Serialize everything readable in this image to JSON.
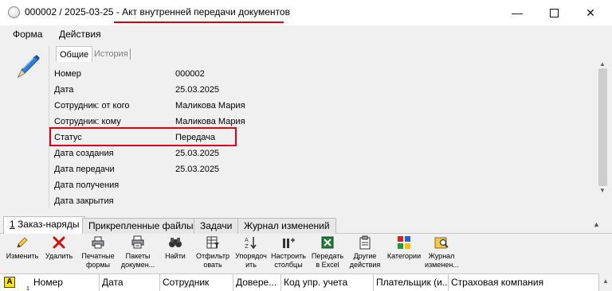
{
  "window": {
    "title_prefix": "000002 / 2025-03-25 - ",
    "title_main": "Акт внутренней передачи документов",
    "minimize": "—",
    "close": "✕"
  },
  "menu": {
    "items": [
      "Форма",
      "Действия"
    ]
  },
  "top_tabs": {
    "active": "Общие",
    "inactive": "История"
  },
  "fields": [
    {
      "label": "Номер",
      "value": "000002"
    },
    {
      "label": "Дата",
      "value": "25.03.2025"
    },
    {
      "label": "Сотрудник: от кого",
      "value": "Маликова Мария"
    },
    {
      "label": "Сотрудник: кому",
      "value": "Маликова Мария"
    },
    {
      "label": "Статус",
      "value": "Передача"
    },
    {
      "label": "Дата создания",
      "value": "25.03.2025"
    },
    {
      "label": "Дата передачи",
      "value": "25.03.2025"
    },
    {
      "label": "Дата получения",
      "value": ""
    },
    {
      "label": "Дата закрытия",
      "value": ""
    }
  ],
  "bottom_tabs": {
    "tab1_num": "1",
    "tab1_label": " Заказ-наряды",
    "tab2_label": "Прикрепленные файлы",
    "tab3_label": "Задачи",
    "tab4_label": "Журнал изменений"
  },
  "toolbar": {
    "edit": "Изменить",
    "delete": "Удалить",
    "print_forms_1": "Печатные",
    "print_forms_2": "формы",
    "packages_1": "Пакеты",
    "packages_2": "докумен...",
    "find": "Найти",
    "filter_1": "Отфильтр",
    "filter_2": "овать",
    "sort_1": "Упорядоч",
    "sort_2": "ить",
    "columns_1": "Настроить",
    "columns_2": "столбцы",
    "excel_1": "Передать",
    "excel_2": "в Excel",
    "other_1": "Другие",
    "other_2": "действия",
    "categories": "Категории",
    "journal_1": "Журнал",
    "journal_2": "изменен..."
  },
  "grid": {
    "badge": "A",
    "row_num": "1",
    "headers": [
      "Номер",
      "Дата",
      "Сотрудник",
      "Довере...",
      "Код упр. учета",
      "Плательщик (и...",
      "Страховая компания"
    ]
  },
  "colors": {
    "highlight": "#e00016",
    "title_underline": "#d6001c",
    "background": "#f0f0f0"
  }
}
